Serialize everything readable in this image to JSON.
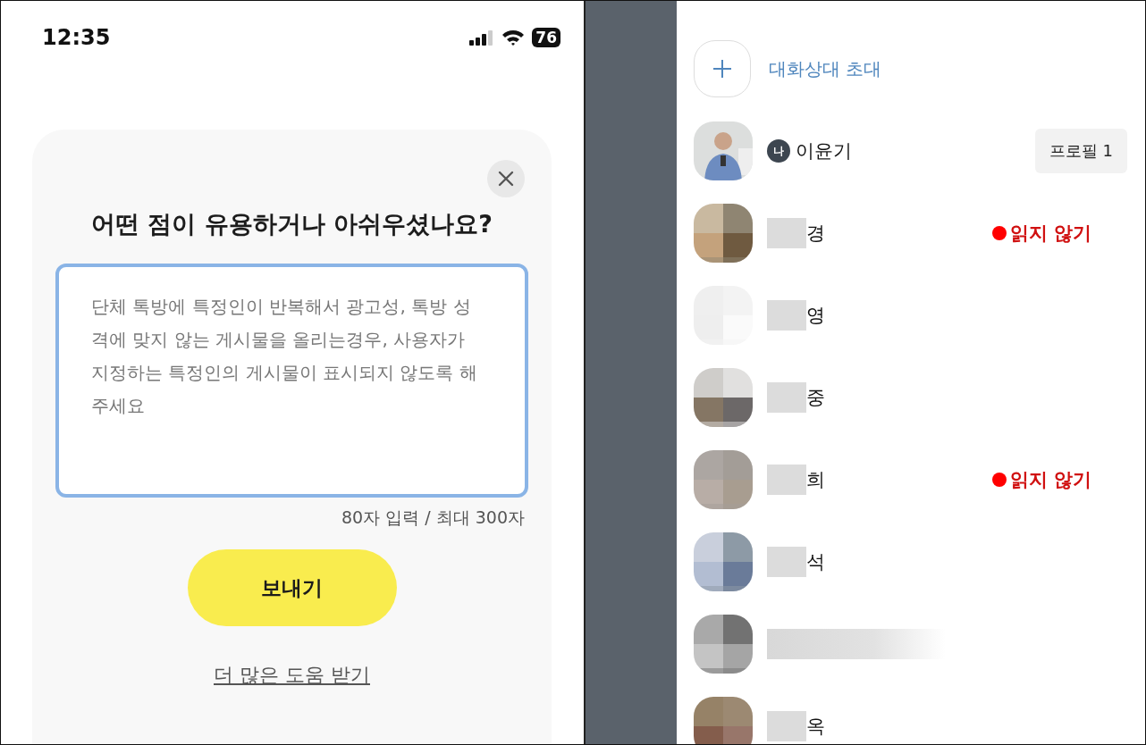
{
  "left": {
    "status_bar": {
      "time": "12:35",
      "battery": "76"
    },
    "dialog": {
      "title": "어떤 점이 유용하거나 아쉬우셨나요?",
      "feedback_field": {
        "value": "단체 톡방에 특정인이 반복해서 광고성, 톡방 성격에 맞지 않는 게시물을 올리는경우, 사용자가 지정하는 특정인의 게시물이 표시되지 않도록 해주세요"
      },
      "char_count": "80자 입력 / 최대 300자",
      "send_button": "보내기",
      "help_link": "더 많은 도움 받기"
    }
  },
  "right": {
    "invite": {
      "label": "대화상대 초대"
    },
    "me": {
      "avatar": {
        "kind": "picture"
      },
      "badge": "나",
      "name": "이윤기",
      "profile_button": "프로필 1"
    },
    "members": [
      {
        "avatar": {
          "kind": "picture"
        },
        "name": "경",
        "note": "읽지 않기"
      },
      {
        "avatar": {
          "kind": "picture"
        },
        "name": "영"
      },
      {
        "avatar": {
          "kind": "picture"
        },
        "name": "중"
      },
      {
        "avatar": {
          "kind": "picture"
        },
        "name": "희",
        "note": "읽지 않기"
      },
      {
        "avatar": {
          "kind": "picture"
        },
        "name": "석"
      },
      {
        "avatar": {
          "kind": "picture"
        }
      },
      {
        "avatar": {
          "kind": "picture"
        },
        "name": "옥"
      }
    ]
  }
}
